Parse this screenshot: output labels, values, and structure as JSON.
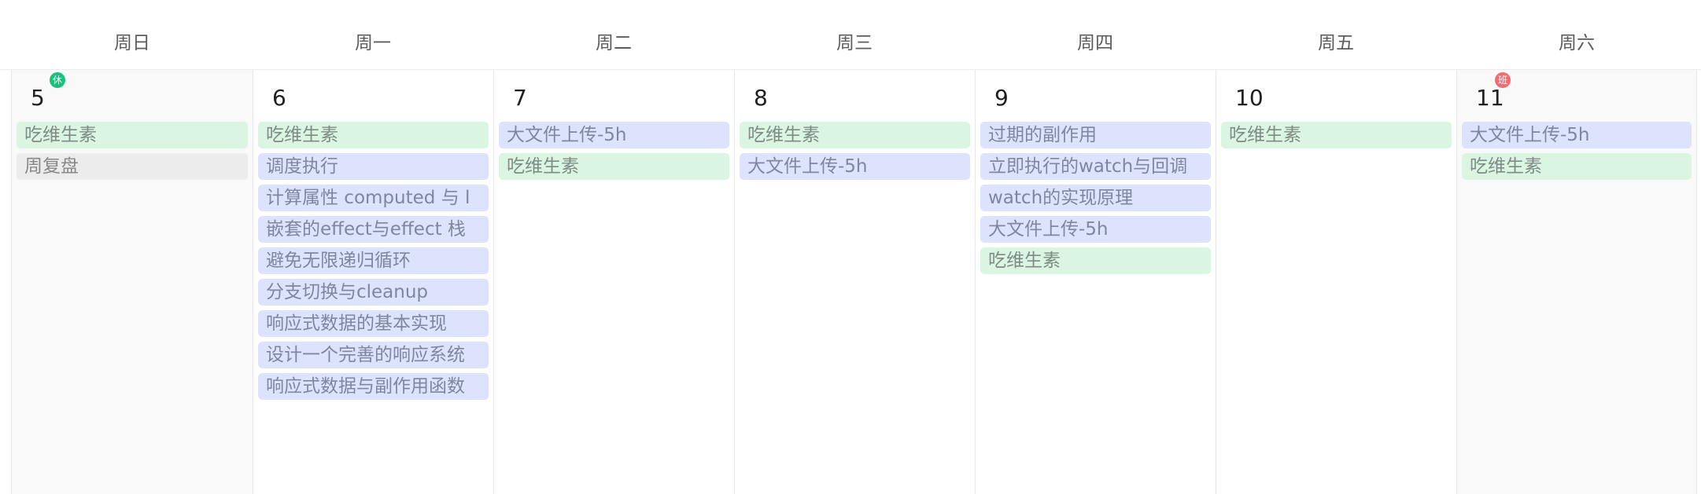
{
  "calendar": {
    "weekdays": [
      "周日",
      "周一",
      "周二",
      "周三",
      "周四",
      "周五",
      "周六"
    ],
    "days": [
      {
        "number": "5",
        "badge": "休",
        "badge_type": "rest",
        "events": [
          {
            "title": "吃维生素",
            "color": "green"
          },
          {
            "title": "周复盘",
            "color": "gray"
          }
        ]
      },
      {
        "number": "6",
        "events": [
          {
            "title": "吃维生素",
            "color": "green"
          },
          {
            "title": "调度执行",
            "color": "blue"
          },
          {
            "title": "计算属性 computed 与 l",
            "color": "blue"
          },
          {
            "title": "嵌套的effect与effect 栈",
            "color": "blue"
          },
          {
            "title": "避免无限递归循环",
            "color": "blue"
          },
          {
            "title": "分支切换与cleanup",
            "color": "blue"
          },
          {
            "title": "响应式数据的基本实现",
            "color": "blue"
          },
          {
            "title": "设计一个完善的响应系统",
            "color": "blue"
          },
          {
            "title": "响应式数据与副作用函数",
            "color": "blue"
          }
        ]
      },
      {
        "number": "7",
        "events": [
          {
            "title": "大文件上传-5h",
            "color": "blue"
          },
          {
            "title": "吃维生素",
            "color": "green"
          }
        ]
      },
      {
        "number": "8",
        "events": [
          {
            "title": "吃维生素",
            "color": "green"
          },
          {
            "title": "大文件上传-5h",
            "color": "blue"
          }
        ]
      },
      {
        "number": "9",
        "events": [
          {
            "title": "过期的副作用",
            "color": "blue"
          },
          {
            "title": "立即执行的watch与回调",
            "color": "blue"
          },
          {
            "title": "watch的实现原理",
            "color": "blue"
          },
          {
            "title": "大文件上传-5h",
            "color": "blue"
          },
          {
            "title": "吃维生素",
            "color": "green"
          }
        ]
      },
      {
        "number": "10",
        "events": [
          {
            "title": "吃维生素",
            "color": "green"
          }
        ]
      },
      {
        "number": "11",
        "badge": "班",
        "badge_type": "work",
        "events": [
          {
            "title": "大文件上传-5h",
            "color": "blue"
          },
          {
            "title": "吃维生素",
            "color": "green"
          }
        ]
      }
    ],
    "colors": {
      "green_event_bg": "#daf6e3",
      "blue_event_bg": "#dde3fc",
      "gray_event_bg": "#ececec",
      "rest_badge": "#19c27c",
      "work_badge": "#f26b72"
    }
  }
}
